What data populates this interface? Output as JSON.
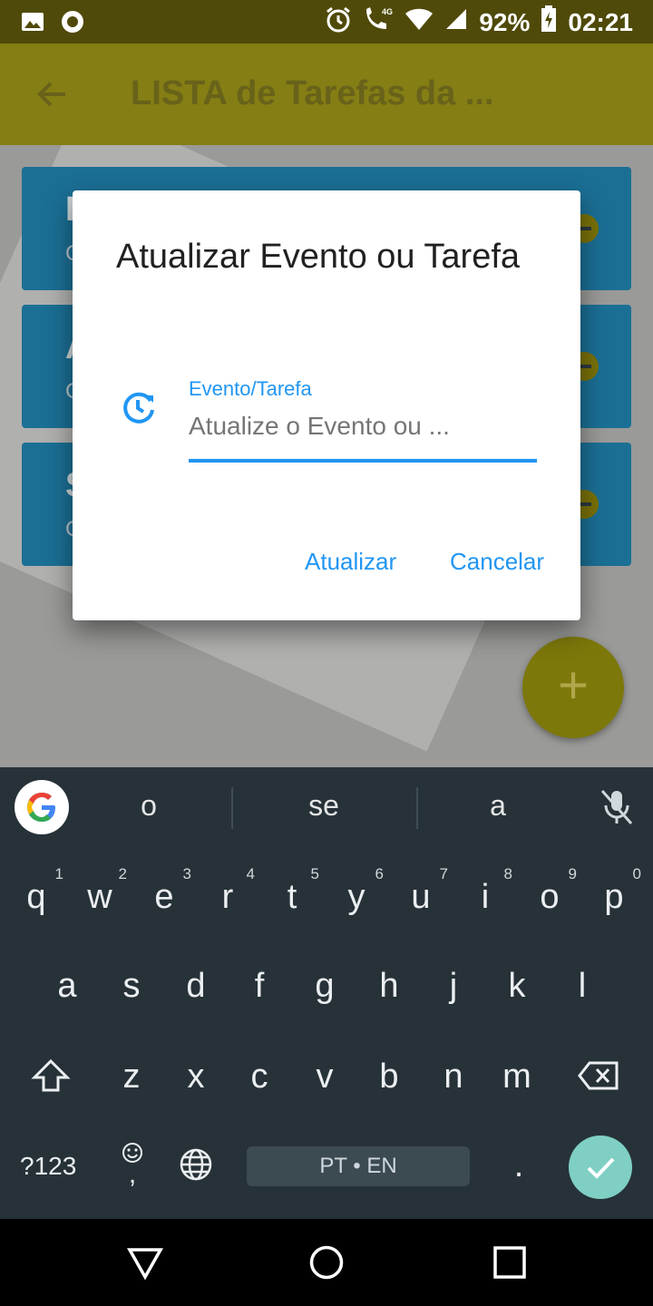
{
  "status_bar": {
    "battery": "92%",
    "time": "02:21",
    "network": "4G"
  },
  "app_bar": {
    "title": "LISTA de Tarefas da ..."
  },
  "cards": [
    {
      "letter": "E",
      "sub": "C"
    },
    {
      "letter": "A",
      "sub": "C"
    },
    {
      "letter": "S",
      "sub": "C"
    }
  ],
  "fab": {
    "label": "+"
  },
  "dialog": {
    "title": "Atualizar Evento ou Tarefa",
    "field_label": "Evento/Tarefa",
    "field_placeholder": "Atualize o Evento ou ...",
    "update_button": "Atualizar",
    "cancel_button": "Cancelar"
  },
  "keyboard": {
    "suggestions": [
      "o",
      "se",
      "a"
    ],
    "row1": [
      {
        "k": "q",
        "h": "1"
      },
      {
        "k": "w",
        "h": "2"
      },
      {
        "k": "e",
        "h": "3"
      },
      {
        "k": "r",
        "h": "4"
      },
      {
        "k": "t",
        "h": "5"
      },
      {
        "k": "y",
        "h": "6"
      },
      {
        "k": "u",
        "h": "7"
      },
      {
        "k": "i",
        "h": "8"
      },
      {
        "k": "o",
        "h": "9"
      },
      {
        "k": "p",
        "h": "0"
      }
    ],
    "row2": [
      "a",
      "s",
      "d",
      "f",
      "g",
      "h",
      "j",
      "k",
      "l"
    ],
    "row3": [
      "z",
      "x",
      "c",
      "v",
      "b",
      "n",
      "m"
    ],
    "symbols_key": "?123",
    "comma_key": ",",
    "period_key": ".",
    "space_label": "PT • EN"
  },
  "colors": {
    "accent": "#2196f3",
    "app_bar": "#847e14",
    "keyboard_bg": "#263238",
    "done_key": "#7fcfc4"
  }
}
